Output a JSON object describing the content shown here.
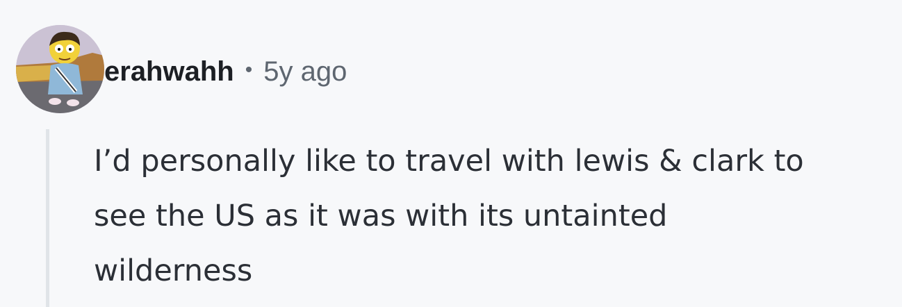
{
  "comment": {
    "avatar_icon": "cartoon-character-avatar-icon",
    "username": "erahwahh",
    "separator": "•",
    "timestamp": "5y ago",
    "body_lines": [
      "I’d personally like to travel with lewis & clark to",
      "see the US as it was with its untainted",
      "wilderness"
    ]
  },
  "colors": {
    "background": "#f7f8fa",
    "username": "#1c1f24",
    "meta_text": "#5e6670",
    "body_text": "#2b2f36",
    "thread_line": "#e0e4e8"
  }
}
